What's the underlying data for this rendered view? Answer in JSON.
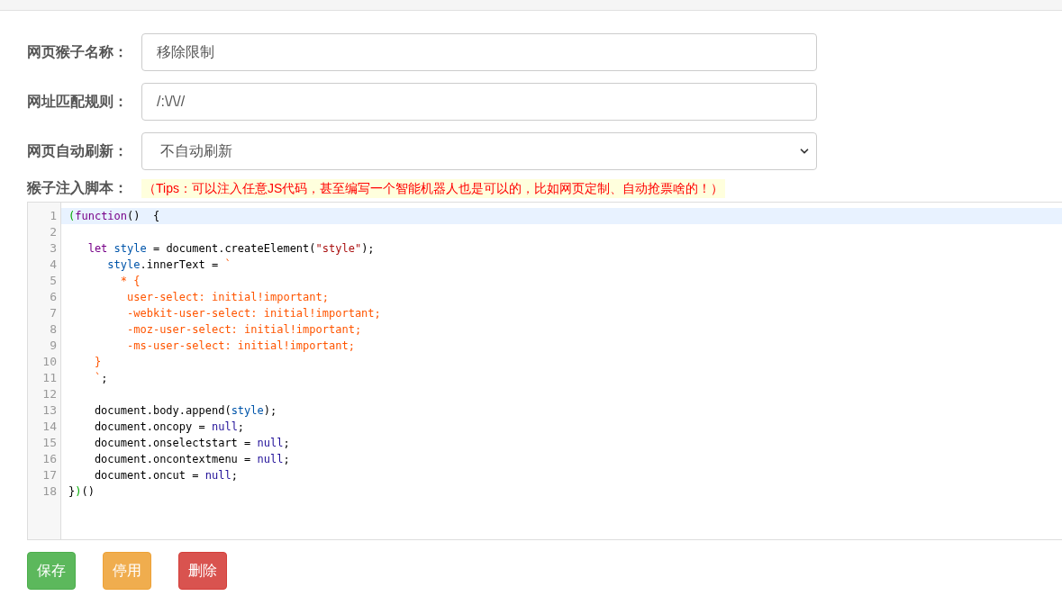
{
  "form": {
    "fields": [
      {
        "label": "网页猴子名称：",
        "kind": "text",
        "value": "移除限制"
      },
      {
        "label": "网址匹配规则：",
        "kind": "text",
        "value": "/:\\/\\//"
      },
      {
        "label": "网页自动刷新：",
        "kind": "select",
        "value": "不自动刷新"
      }
    ],
    "script_label": "猴子注入脚本：",
    "tip": "（Tips：可以注入任意JS代码，甚至编写一个智能机器人也是可以的，比如网页定制、自动抢票啥的！）"
  },
  "editor": {
    "lines": [
      {
        "number": "1",
        "active": true,
        "tokens": [
          {
            "kind": "bracket",
            "text": "("
          },
          {
            "kind": "keyword",
            "text": "function"
          },
          {
            "kind": "plain",
            "text": "()  {"
          }
        ]
      },
      {
        "number": "2",
        "active": false
      },
      {
        "number": "3",
        "active": false,
        "tokens": [
          {
            "kind": "keyword",
            "text": "   let "
          },
          {
            "kind": "variable",
            "text": "style"
          },
          {
            "kind": "plain",
            "text": " = document.createElement("
          },
          {
            "kind": "string",
            "text": "\"style\""
          },
          {
            "kind": "plain",
            "text": ");"
          }
        ]
      },
      {
        "number": "4",
        "active": false,
        "tokens": [
          {
            "kind": "variable",
            "text": "      style"
          },
          {
            "kind": "plain",
            "text": ".innerText = "
          },
          {
            "kind": "css",
            "text": "`"
          }
        ]
      },
      {
        "number": "5",
        "active": false,
        "tokens": [
          {
            "kind": "css",
            "text": "        * {"
          }
        ]
      },
      {
        "number": "6",
        "active": false,
        "tokens": [
          {
            "kind": "css",
            "text": "         user-select: initial!important;"
          }
        ]
      },
      {
        "number": "7",
        "active": false,
        "tokens": [
          {
            "kind": "css",
            "text": "         -webkit-user-select: initial!important;"
          }
        ]
      },
      {
        "number": "8",
        "active": false,
        "tokens": [
          {
            "kind": "css",
            "text": "         -moz-user-select: initial!important;"
          }
        ]
      },
      {
        "number": "9",
        "active": false,
        "tokens": [
          {
            "kind": "css",
            "text": "         -ms-user-select: initial!important;"
          }
        ]
      },
      {
        "number": "10",
        "active": false,
        "tokens": [
          {
            "kind": "css",
            "text": "    }"
          }
        ]
      },
      {
        "number": "11",
        "active": false,
        "tokens": [
          {
            "kind": "css",
            "text": "    `"
          },
          {
            "kind": "plain",
            "text": ";"
          }
        ]
      },
      {
        "number": "12",
        "active": false
      },
      {
        "number": "13",
        "active": false,
        "tokens": [
          {
            "kind": "plain",
            "text": "    document.body.append("
          },
          {
            "kind": "variable",
            "text": "style"
          },
          {
            "kind": "plain",
            "text": ");"
          }
        ]
      },
      {
        "number": "14",
        "active": false,
        "tokens": [
          {
            "kind": "plain",
            "text": "    document.oncopy = "
          },
          {
            "kind": "atom",
            "text": "null"
          },
          {
            "kind": "plain",
            "text": ";"
          }
        ]
      },
      {
        "number": "15",
        "active": false,
        "tokens": [
          {
            "kind": "plain",
            "text": "    document.onselectstart = "
          },
          {
            "kind": "atom",
            "text": "null"
          },
          {
            "kind": "plain",
            "text": ";"
          }
        ]
      },
      {
        "number": "16",
        "active": false,
        "tokens": [
          {
            "kind": "plain",
            "text": "    document.oncontextmenu = "
          },
          {
            "kind": "atom",
            "text": "null"
          },
          {
            "kind": "plain",
            "text": ";"
          }
        ]
      },
      {
        "number": "17",
        "active": false,
        "tokens": [
          {
            "kind": "plain",
            "text": "    document.oncut = "
          },
          {
            "kind": "atom",
            "text": "null"
          },
          {
            "kind": "plain",
            "text": ";"
          }
        ]
      },
      {
        "number": "18",
        "active": false,
        "tokens": [
          {
            "kind": "plain",
            "text": "}"
          },
          {
            "kind": "bracket",
            "text": ")"
          },
          {
            "kind": "plain",
            "text": "()"
          }
        ]
      }
    ]
  },
  "buttons": [
    {
      "label": "保存",
      "kind": "success"
    },
    {
      "label": "停用",
      "kind": "warning"
    },
    {
      "label": "删除",
      "kind": "danger"
    }
  ]
}
